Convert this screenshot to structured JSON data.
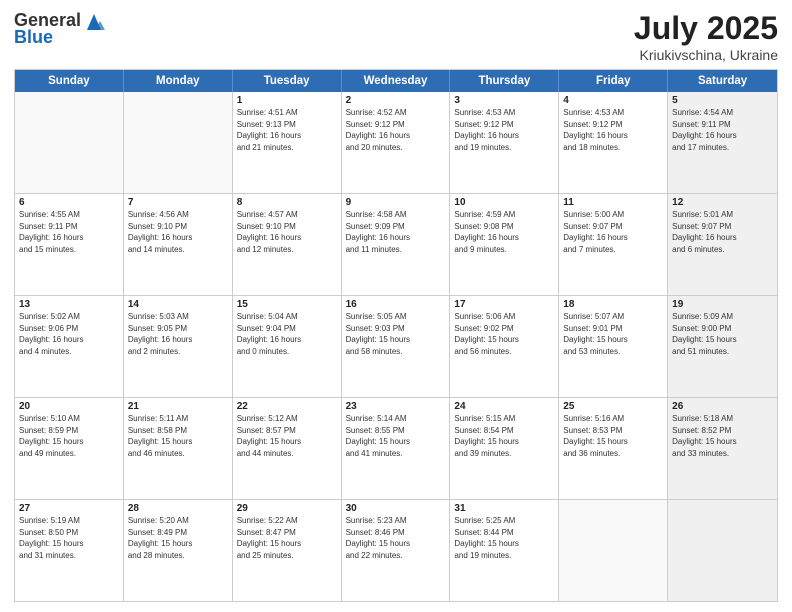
{
  "header": {
    "logo_general": "General",
    "logo_blue": "Blue",
    "title": "July 2025",
    "subtitle": "Kriukivschina, Ukraine"
  },
  "days_of_week": [
    "Sunday",
    "Monday",
    "Tuesday",
    "Wednesday",
    "Thursday",
    "Friday",
    "Saturday"
  ],
  "weeks": [
    [
      {
        "day": "",
        "info": "",
        "shaded": true
      },
      {
        "day": "",
        "info": "",
        "shaded": false
      },
      {
        "day": "1",
        "info": "Sunrise: 4:51 AM\nSunset: 9:13 PM\nDaylight: 16 hours\nand 21 minutes."
      },
      {
        "day": "2",
        "info": "Sunrise: 4:52 AM\nSunset: 9:12 PM\nDaylight: 16 hours\nand 20 minutes."
      },
      {
        "day": "3",
        "info": "Sunrise: 4:53 AM\nSunset: 9:12 PM\nDaylight: 16 hours\nand 19 minutes."
      },
      {
        "day": "4",
        "info": "Sunrise: 4:53 AM\nSunset: 9:12 PM\nDaylight: 16 hours\nand 18 minutes."
      },
      {
        "day": "5",
        "info": "Sunrise: 4:54 AM\nSunset: 9:11 PM\nDaylight: 16 hours\nand 17 minutes.",
        "shaded": true
      }
    ],
    [
      {
        "day": "6",
        "info": "Sunrise: 4:55 AM\nSunset: 9:11 PM\nDaylight: 16 hours\nand 15 minutes."
      },
      {
        "day": "7",
        "info": "Sunrise: 4:56 AM\nSunset: 9:10 PM\nDaylight: 16 hours\nand 14 minutes."
      },
      {
        "day": "8",
        "info": "Sunrise: 4:57 AM\nSunset: 9:10 PM\nDaylight: 16 hours\nand 12 minutes."
      },
      {
        "day": "9",
        "info": "Sunrise: 4:58 AM\nSunset: 9:09 PM\nDaylight: 16 hours\nand 11 minutes."
      },
      {
        "day": "10",
        "info": "Sunrise: 4:59 AM\nSunset: 9:08 PM\nDaylight: 16 hours\nand 9 minutes."
      },
      {
        "day": "11",
        "info": "Sunrise: 5:00 AM\nSunset: 9:07 PM\nDaylight: 16 hours\nand 7 minutes."
      },
      {
        "day": "12",
        "info": "Sunrise: 5:01 AM\nSunset: 9:07 PM\nDaylight: 16 hours\nand 6 minutes.",
        "shaded": true
      }
    ],
    [
      {
        "day": "13",
        "info": "Sunrise: 5:02 AM\nSunset: 9:06 PM\nDaylight: 16 hours\nand 4 minutes."
      },
      {
        "day": "14",
        "info": "Sunrise: 5:03 AM\nSunset: 9:05 PM\nDaylight: 16 hours\nand 2 minutes."
      },
      {
        "day": "15",
        "info": "Sunrise: 5:04 AM\nSunset: 9:04 PM\nDaylight: 16 hours\nand 0 minutes."
      },
      {
        "day": "16",
        "info": "Sunrise: 5:05 AM\nSunset: 9:03 PM\nDaylight: 15 hours\nand 58 minutes."
      },
      {
        "day": "17",
        "info": "Sunrise: 5:06 AM\nSunset: 9:02 PM\nDaylight: 15 hours\nand 56 minutes."
      },
      {
        "day": "18",
        "info": "Sunrise: 5:07 AM\nSunset: 9:01 PM\nDaylight: 15 hours\nand 53 minutes."
      },
      {
        "day": "19",
        "info": "Sunrise: 5:09 AM\nSunset: 9:00 PM\nDaylight: 15 hours\nand 51 minutes.",
        "shaded": true
      }
    ],
    [
      {
        "day": "20",
        "info": "Sunrise: 5:10 AM\nSunset: 8:59 PM\nDaylight: 15 hours\nand 49 minutes."
      },
      {
        "day": "21",
        "info": "Sunrise: 5:11 AM\nSunset: 8:58 PM\nDaylight: 15 hours\nand 46 minutes."
      },
      {
        "day": "22",
        "info": "Sunrise: 5:12 AM\nSunset: 8:57 PM\nDaylight: 15 hours\nand 44 minutes."
      },
      {
        "day": "23",
        "info": "Sunrise: 5:14 AM\nSunset: 8:55 PM\nDaylight: 15 hours\nand 41 minutes."
      },
      {
        "day": "24",
        "info": "Sunrise: 5:15 AM\nSunset: 8:54 PM\nDaylight: 15 hours\nand 39 minutes."
      },
      {
        "day": "25",
        "info": "Sunrise: 5:16 AM\nSunset: 8:53 PM\nDaylight: 15 hours\nand 36 minutes."
      },
      {
        "day": "26",
        "info": "Sunrise: 5:18 AM\nSunset: 8:52 PM\nDaylight: 15 hours\nand 33 minutes.",
        "shaded": true
      }
    ],
    [
      {
        "day": "27",
        "info": "Sunrise: 5:19 AM\nSunset: 8:50 PM\nDaylight: 15 hours\nand 31 minutes."
      },
      {
        "day": "28",
        "info": "Sunrise: 5:20 AM\nSunset: 8:49 PM\nDaylight: 15 hours\nand 28 minutes."
      },
      {
        "day": "29",
        "info": "Sunrise: 5:22 AM\nSunset: 8:47 PM\nDaylight: 15 hours\nand 25 minutes."
      },
      {
        "day": "30",
        "info": "Sunrise: 5:23 AM\nSunset: 8:46 PM\nDaylight: 15 hours\nand 22 minutes."
      },
      {
        "day": "31",
        "info": "Sunrise: 5:25 AM\nSunset: 8:44 PM\nDaylight: 15 hours\nand 19 minutes."
      },
      {
        "day": "",
        "info": "",
        "shaded": false
      },
      {
        "day": "",
        "info": "",
        "shaded": true
      }
    ]
  ]
}
